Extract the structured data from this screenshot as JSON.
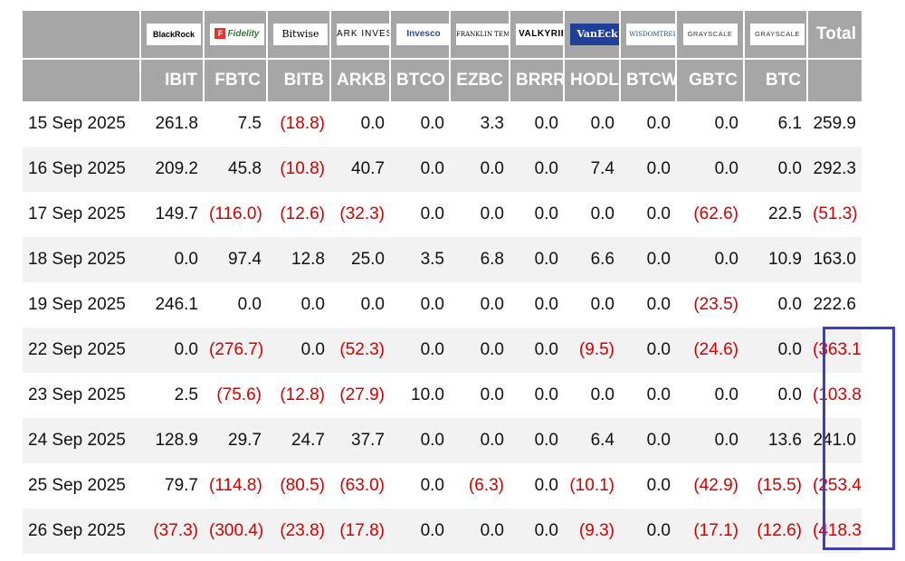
{
  "colors": {
    "header_bg": "#a6a6a6",
    "negative": "#d40000",
    "highlight_border": "#3c3cc6",
    "stripe": "#f2f2f2"
  },
  "logos": [
    {
      "text": "BlackRock",
      "class": "blackrock",
      "icon": "blackrock-logo"
    },
    {
      "text": "Fidelity",
      "class": "fidelity",
      "icon": "fidelity-logo"
    },
    {
      "text": "Bitwise",
      "class": "bitwise",
      "icon": "bitwise-logo"
    },
    {
      "text": "ARK INVEST",
      "class": "ark",
      "icon": "ark-invest-logo"
    },
    {
      "text": "Invesco",
      "class": "invesco",
      "icon": "invesco-logo"
    },
    {
      "text": "FRANKLIN TEMPLETON",
      "class": "franklin",
      "icon": "franklin-templeton-logo"
    },
    {
      "text": "VALKYRIE",
      "class": "valkyrie",
      "icon": "valkyrie-logo"
    },
    {
      "text": "VanEck",
      "class": "vaneck",
      "icon": "vaneck-logo"
    },
    {
      "text": "WISDOMTREE",
      "class": "wisdomtree",
      "icon": "wisdomtree-logo"
    },
    {
      "text": "GRAYSCALE",
      "class": "grayscale",
      "icon": "grayscale-logo"
    },
    {
      "text": "GRAYSCALE",
      "class": "grayscale",
      "icon": "grayscale-logo"
    }
  ],
  "total_header": "Total",
  "tickers": [
    "IBIT",
    "FBTC",
    "BITB",
    "ARKB",
    "BTCO",
    "EZBC",
    "BRRR",
    "HODL",
    "BTCW",
    "GBTC",
    "BTC"
  ],
  "rows": [
    {
      "date": "15 Sep 2025",
      "values": [
        "261.8",
        "7.5",
        "(18.8)",
        "0.0",
        "0.0",
        "3.3",
        "0.0",
        "0.0",
        "0.0",
        "0.0",
        "6.1"
      ],
      "total": "259.9"
    },
    {
      "date": "16 Sep 2025",
      "values": [
        "209.2",
        "45.8",
        "(10.8)",
        "40.7",
        "0.0",
        "0.0",
        "0.0",
        "7.4",
        "0.0",
        "0.0",
        "0.0"
      ],
      "total": "292.3"
    },
    {
      "date": "17 Sep 2025",
      "values": [
        "149.7",
        "(116.0)",
        "(12.6)",
        "(32.3)",
        "0.0",
        "0.0",
        "0.0",
        "0.0",
        "0.0",
        "(62.6)",
        "22.5"
      ],
      "total": "(51.3)"
    },
    {
      "date": "18 Sep 2025",
      "values": [
        "0.0",
        "97.4",
        "12.8",
        "25.0",
        "3.5",
        "6.8",
        "0.0",
        "6.6",
        "0.0",
        "0.0",
        "10.9"
      ],
      "total": "163.0"
    },
    {
      "date": "19 Sep 2025",
      "values": [
        "246.1",
        "0.0",
        "0.0",
        "0.0",
        "0.0",
        "0.0",
        "0.0",
        "0.0",
        "0.0",
        "(23.5)",
        "0.0"
      ],
      "total": "222.6"
    },
    {
      "date": "22 Sep 2025",
      "values": [
        "0.0",
        "(276.7)",
        "0.0",
        "(52.3)",
        "0.0",
        "0.0",
        "0.0",
        "(9.5)",
        "0.0",
        "(24.6)",
        "0.0"
      ],
      "total": "(363.1)"
    },
    {
      "date": "23 Sep 2025",
      "values": [
        "2.5",
        "(75.6)",
        "(12.8)",
        "(27.9)",
        "10.0",
        "0.0",
        "0.0",
        "0.0",
        "0.0",
        "0.0",
        "0.0"
      ],
      "total": "(103.8)"
    },
    {
      "date": "24 Sep 2025",
      "values": [
        "128.9",
        "29.7",
        "24.7",
        "37.7",
        "0.0",
        "0.0",
        "0.0",
        "6.4",
        "0.0",
        "0.0",
        "13.6"
      ],
      "total": "241.0"
    },
    {
      "date": "25 Sep 2025",
      "values": [
        "79.7",
        "(114.8)",
        "(80.5)",
        "(63.0)",
        "0.0",
        "(6.3)",
        "0.0",
        "(10.1)",
        "0.0",
        "(42.9)",
        "(15.5)"
      ],
      "total": "(253.4)"
    },
    {
      "date": "26 Sep 2025",
      "values": [
        "(37.3)",
        "(300.4)",
        "(23.8)",
        "(17.8)",
        "0.0",
        "0.0",
        "0.0",
        "(9.3)",
        "0.0",
        "(17.1)",
        "(12.6)"
      ],
      "total": "(418.3)"
    }
  ]
}
